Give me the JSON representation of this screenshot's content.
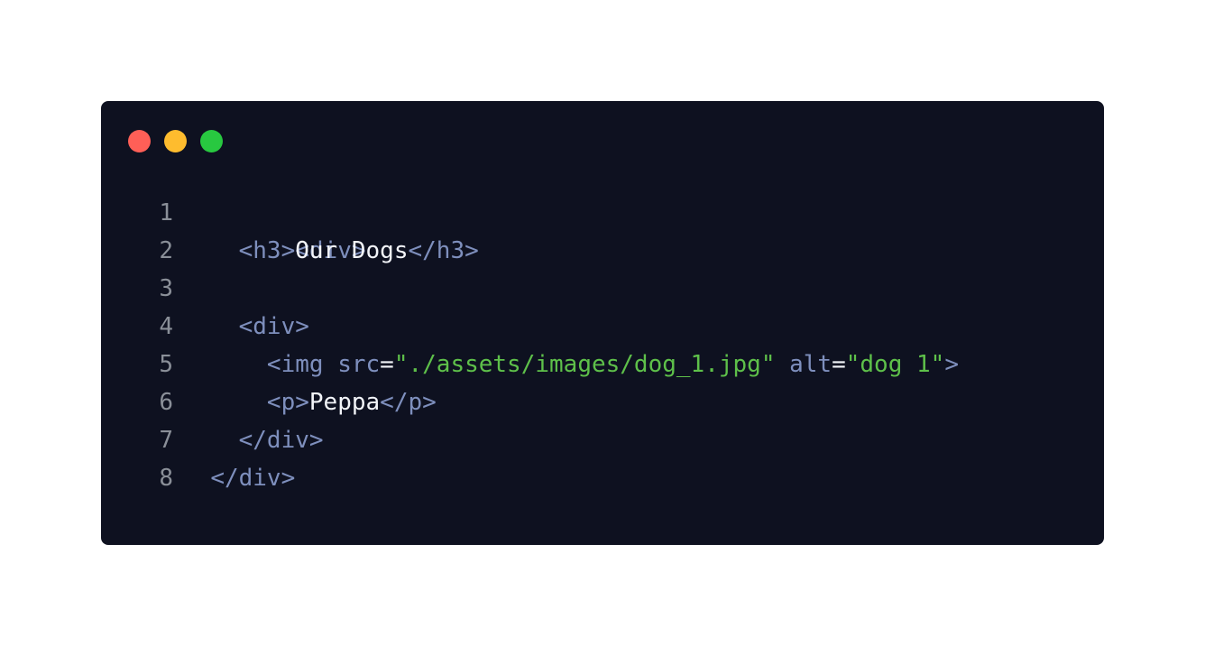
{
  "window": {
    "controls": [
      {
        "name": "close",
        "color": "#ff5f57"
      },
      {
        "name": "minimize",
        "color": "#febc2e"
      },
      {
        "name": "maximize",
        "color": "#28c840"
      }
    ]
  },
  "theme": {
    "background": "#0e1120",
    "tag_color": "#7e8fbd",
    "string_color": "#5ec04a",
    "text_color": "#f2f4f8",
    "line_number_color": "#8a8f98"
  },
  "code": {
    "lines": [
      {
        "number": "1",
        "tokens": [
          {
            "type": "tag",
            "text": "<div>"
          }
        ]
      },
      {
        "number": "2",
        "tokens": [
          {
            "type": "plain",
            "text": "    "
          },
          {
            "type": "tag",
            "text": "<h3>"
          },
          {
            "type": "text",
            "text": "Our Dogs"
          },
          {
            "type": "tag",
            "text": "</h3>"
          }
        ]
      },
      {
        "number": "3",
        "tokens": []
      },
      {
        "number": "4",
        "tokens": [
          {
            "type": "plain",
            "text": "    "
          },
          {
            "type": "tag",
            "text": "<div>"
          }
        ]
      },
      {
        "number": "5",
        "tokens": [
          {
            "type": "plain",
            "text": "      "
          },
          {
            "type": "tag",
            "text": "<img "
          },
          {
            "type": "attr",
            "text": "src"
          },
          {
            "type": "plain",
            "text": "="
          },
          {
            "type": "str",
            "text": "\"./assets/images/dog_1.jpg\""
          },
          {
            "type": "plain",
            "text": " "
          },
          {
            "type": "attr",
            "text": "alt"
          },
          {
            "type": "plain",
            "text": "="
          },
          {
            "type": "str",
            "text": "\"dog 1\""
          },
          {
            "type": "tag",
            "text": ">"
          }
        ]
      },
      {
        "number": "6",
        "tokens": [
          {
            "type": "plain",
            "text": "      "
          },
          {
            "type": "tag",
            "text": "<p>"
          },
          {
            "type": "text",
            "text": "Peppa"
          },
          {
            "type": "tag",
            "text": "</p>"
          }
        ]
      },
      {
        "number": "7",
        "tokens": [
          {
            "type": "plain",
            "text": "    "
          },
          {
            "type": "tag",
            "text": "</div>"
          }
        ]
      },
      {
        "number": "8",
        "tokens": [
          {
            "type": "plain",
            "text": "  "
          },
          {
            "type": "tag",
            "text": "</div>"
          }
        ]
      }
    ]
  }
}
